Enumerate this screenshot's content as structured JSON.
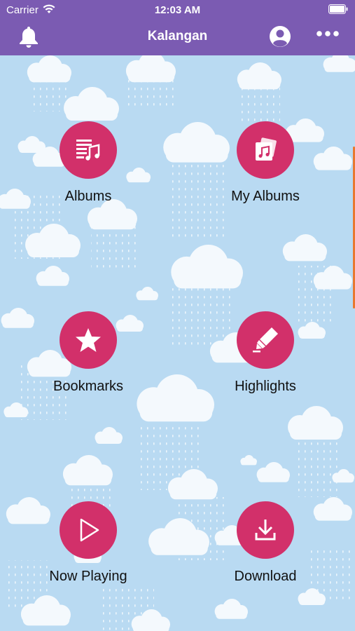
{
  "status_bar": {
    "carrier": "Carrier",
    "time": "12:03 AM"
  },
  "nav": {
    "title": "Kalangan"
  },
  "menu": [
    {
      "label": "Albums",
      "icon": "album-list-icon"
    },
    {
      "label": "My Albums",
      "icon": "my-albums-icon"
    },
    {
      "label": "Bookmarks",
      "icon": "star-icon"
    },
    {
      "label": "Highlights",
      "icon": "highlighter-icon"
    },
    {
      "label": "Now Playing",
      "icon": "play-icon"
    },
    {
      "label": "Download",
      "icon": "download-icon"
    }
  ],
  "colors": {
    "header": "#7b5bb2",
    "button": "#d2306a",
    "background": "#b9daf2",
    "scroll_indicator": "#e8782f"
  }
}
